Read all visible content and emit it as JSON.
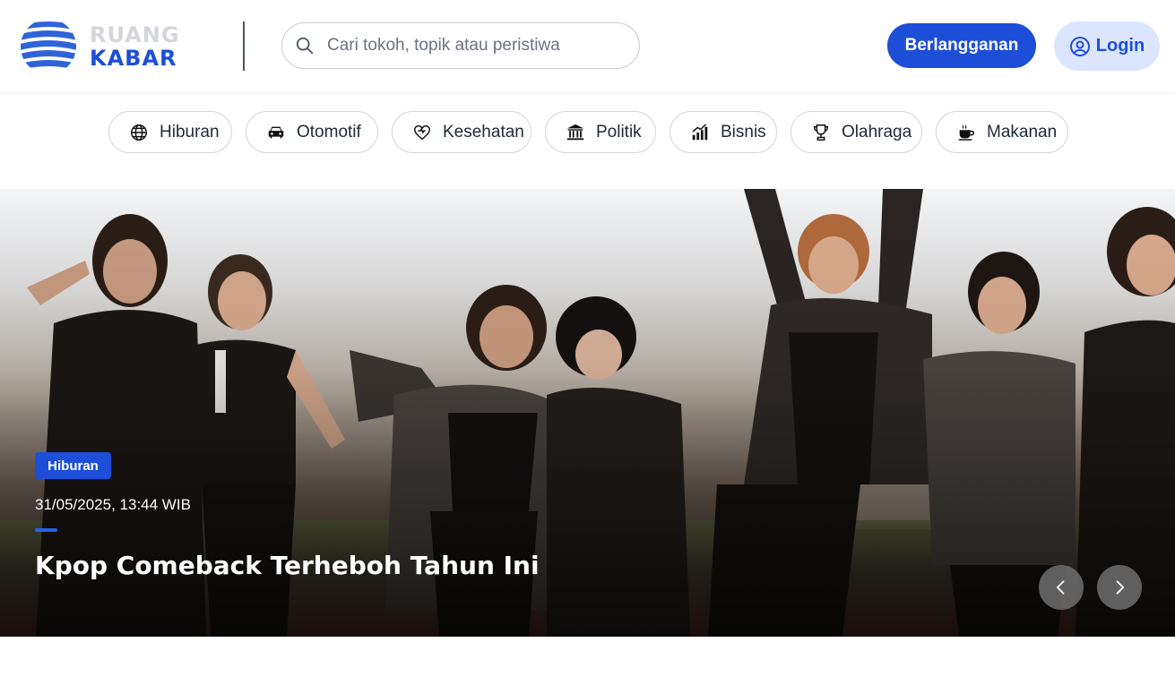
{
  "brand": {
    "line1": "RUANG",
    "line2": "KABAR"
  },
  "search": {
    "placeholder": "Cari tokoh, topik atau peristiwa"
  },
  "header": {
    "subscribe_label": "Berlangganan",
    "login_label": "Login"
  },
  "categories": [
    {
      "label": "Hiburan",
      "icon": "globe-icon"
    },
    {
      "label": "Otomotif",
      "icon": "car-icon"
    },
    {
      "label": "Kesehatan",
      "icon": "heart-icon"
    },
    {
      "label": "Politik",
      "icon": "government-building-icon"
    },
    {
      "label": "Bisnis",
      "icon": "bar-chart-icon"
    },
    {
      "label": "Olahraga",
      "icon": "trophy-icon"
    },
    {
      "label": "Makanan",
      "icon": "coffee-cup-icon"
    }
  ],
  "hero": {
    "category": "Hiburan",
    "date": "31/05/2025, 13:44 WIB",
    "title": "Kpop Comeback Terheboh Tahun Ini"
  },
  "colors": {
    "primary": "#1d4ed8",
    "login_bg": "#dbe6fe",
    "badge": "#1d4ed8"
  }
}
